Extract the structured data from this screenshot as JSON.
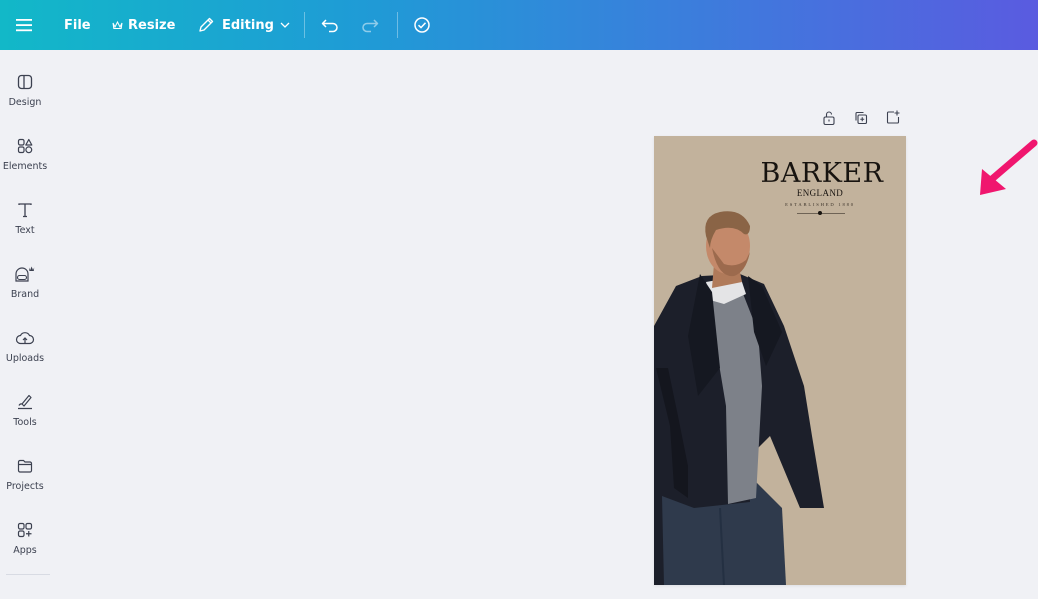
{
  "topbar": {
    "menu_icon": "hamburger-menu-icon",
    "file_label": "File",
    "resize_label": "Resize",
    "editing_label": "Editing",
    "undo_icon": "undo-icon",
    "redo_icon": "redo-icon",
    "cloud_icon": "cloud-saved-check-icon"
  },
  "sidebar": {
    "items": [
      {
        "label": "Design",
        "icon": "design-layout-icon"
      },
      {
        "label": "Elements",
        "icon": "elements-shapes-icon"
      },
      {
        "label": "Text",
        "icon": "text-t-icon"
      },
      {
        "label": "Brand",
        "icon": "brand-kit-icon"
      },
      {
        "label": "Uploads",
        "icon": "cloud-upload-icon"
      },
      {
        "label": "Tools",
        "icon": "pen-tool-icon"
      },
      {
        "label": "Projects",
        "icon": "folder-icon"
      },
      {
        "label": "Apps",
        "icon": "apps-grid-icon"
      }
    ]
  },
  "page_tools": {
    "lock_icon": "lock-icon",
    "duplicate_icon": "duplicate-page-icon",
    "add_icon": "add-page-icon"
  },
  "design": {
    "brand_name": "BARKER",
    "brand_location": "ENGLAND",
    "brand_established": "ESTABLISHED 1880"
  },
  "colors": {
    "topbar_gradient_start": "#12b8c8",
    "topbar_gradient_end": "#5a5be0",
    "canvas_bg": "#f0f1f5",
    "page_bg": "#c2b29c",
    "arrow": "#f0166e"
  }
}
